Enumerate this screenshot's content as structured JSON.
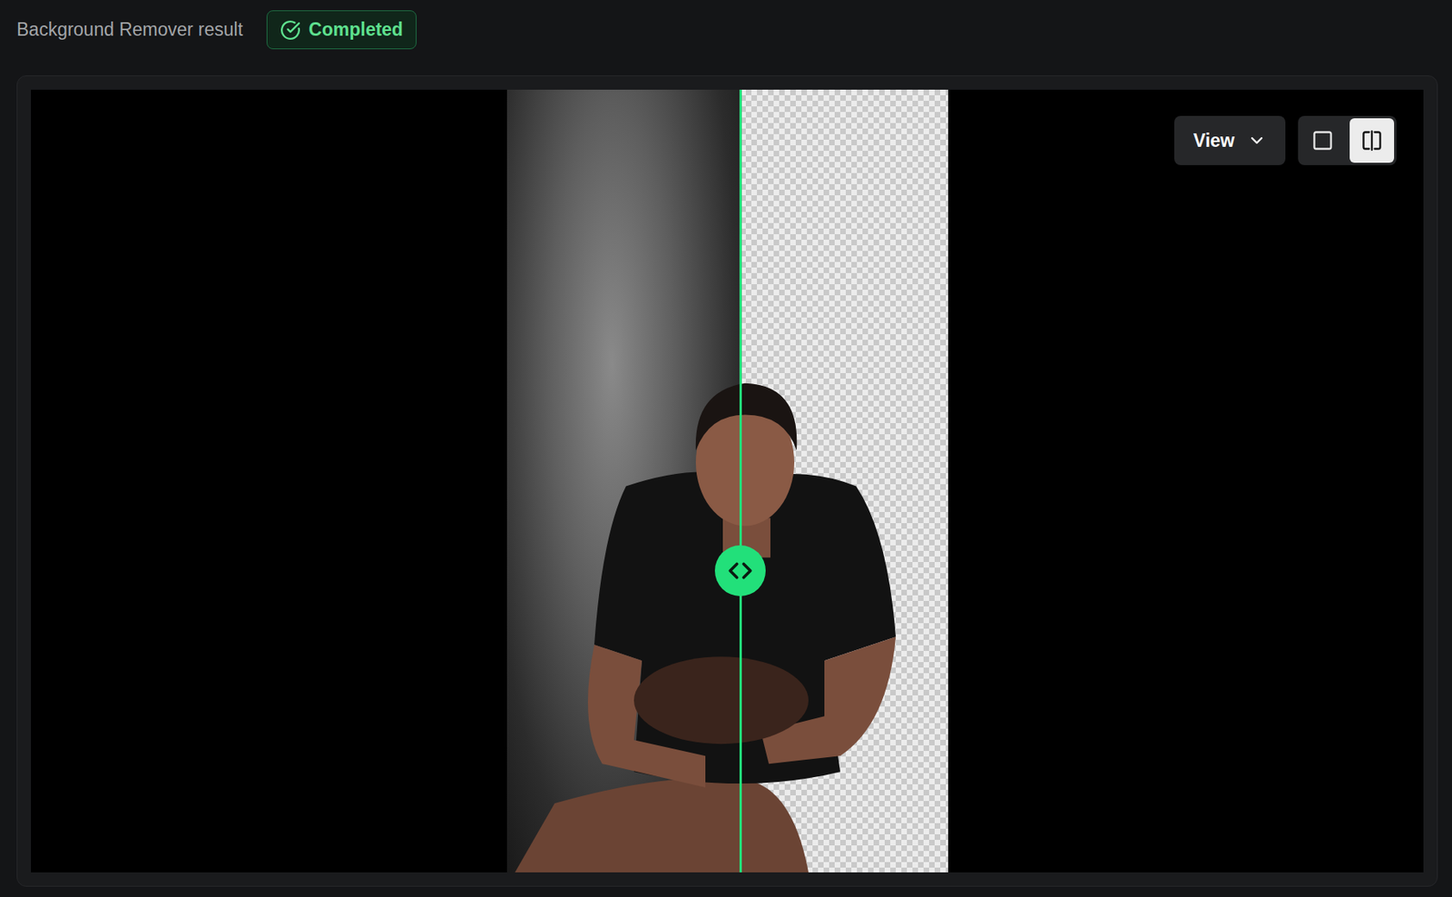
{
  "header": {
    "title": "Background Remover result",
    "status": {
      "label": "Completed",
      "kind": "success"
    }
  },
  "viewer": {
    "split": {
      "level": 0.53
    },
    "view_menu": {
      "label": "View",
      "expanded": false
    },
    "modes": [
      {
        "kind": "single",
        "selected": false
      },
      {
        "kind": "split",
        "selected": true
      }
    ]
  }
}
